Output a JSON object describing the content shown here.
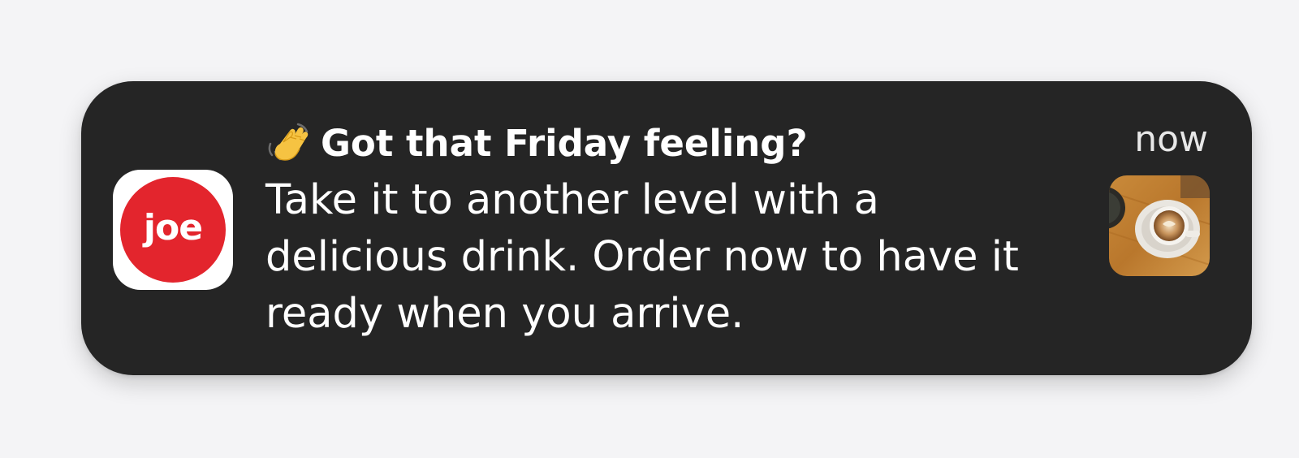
{
  "notification": {
    "app_name": "joe",
    "app_icon_label": "joe",
    "emoji_icon": "waving-hand-icon",
    "title": "Got that Friday feeling?",
    "body": "Take it to another level with a delicious drink. Order now to have it ready when you arrive.",
    "timestamp": "now",
    "thumbnail": "coffee-latte-image",
    "colors": {
      "background": "#252525",
      "app_icon_red": "#e3252d",
      "text": "#ffffff",
      "page_background": "#f4f4f6"
    }
  }
}
